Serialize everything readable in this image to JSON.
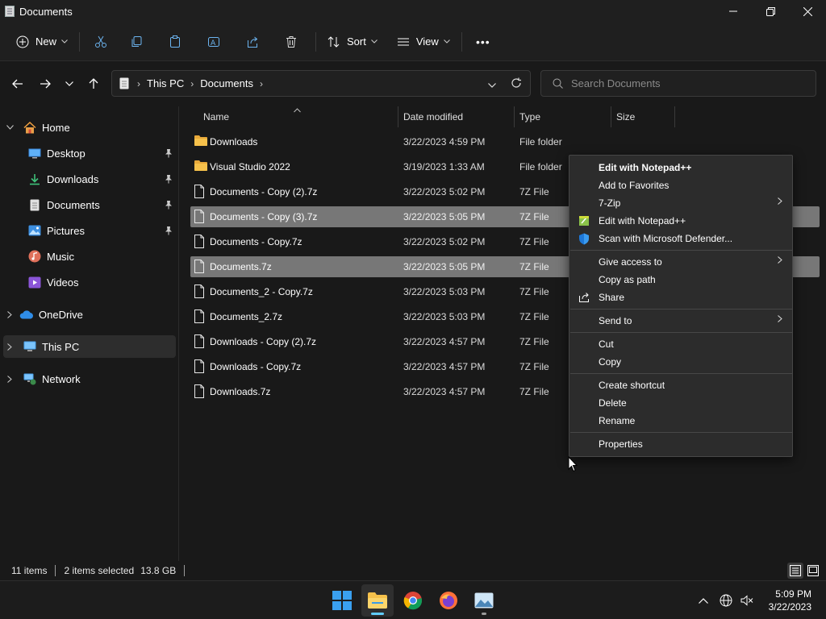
{
  "window": {
    "title": "Documents"
  },
  "toolbar": {
    "new_label": "New",
    "sort_label": "Sort",
    "view_label": "View",
    "more_label": "•••"
  },
  "address": {
    "segments": [
      "This PC",
      "Documents"
    ]
  },
  "search": {
    "placeholder": "Search Documents"
  },
  "sidebar": {
    "items": [
      {
        "label": "Home",
        "icon": "home-icon"
      },
      {
        "label": "Desktop",
        "icon": "desktop-icon",
        "pinned": true
      },
      {
        "label": "Downloads",
        "icon": "download-icon",
        "pinned": true
      },
      {
        "label": "Documents",
        "icon": "document-icon",
        "pinned": true
      },
      {
        "label": "Pictures",
        "icon": "picture-icon",
        "pinned": true
      },
      {
        "label": "Music",
        "icon": "music-icon"
      },
      {
        "label": "Videos",
        "icon": "video-icon"
      },
      {
        "label": "OneDrive",
        "icon": "cloud-icon"
      },
      {
        "label": "This PC",
        "icon": "computer-icon",
        "selected": true
      },
      {
        "label": "Network",
        "icon": "network-icon"
      }
    ]
  },
  "columns": {
    "name": "Name",
    "date": "Date modified",
    "type": "Type",
    "size": "Size"
  },
  "files": [
    {
      "name": "Downloads",
      "date": "3/22/2023 4:59 PM",
      "type": "File folder",
      "kind": "folder",
      "selected": false
    },
    {
      "name": "Visual Studio 2022",
      "date": "3/19/2023 1:33 AM",
      "type": "File folder",
      "kind": "folder",
      "selected": false
    },
    {
      "name": "Documents - Copy (2).7z",
      "date": "3/22/2023 5:02 PM",
      "type": "7Z File",
      "kind": "file",
      "selected": false
    },
    {
      "name": "Documents - Copy (3).7z",
      "date": "3/22/2023 5:05 PM",
      "type": "7Z File",
      "kind": "file",
      "selected": true
    },
    {
      "name": "Documents - Copy.7z",
      "date": "3/22/2023 5:02 PM",
      "type": "7Z File",
      "kind": "file",
      "selected": false
    },
    {
      "name": "Documents.7z",
      "date": "3/22/2023 5:05 PM",
      "type": "7Z File",
      "kind": "file",
      "selected": true
    },
    {
      "name": "Documents_2 - Copy.7z",
      "date": "3/22/2023 5:03 PM",
      "type": "7Z File",
      "kind": "file",
      "selected": false
    },
    {
      "name": "Documents_2.7z",
      "date": "3/22/2023 5:03 PM",
      "type": "7Z File",
      "kind": "file",
      "selected": false
    },
    {
      "name": "Downloads - Copy (2).7z",
      "date": "3/22/2023 4:57 PM",
      "type": "7Z File",
      "kind": "file",
      "selected": false
    },
    {
      "name": "Downloads - Copy.7z",
      "date": "3/22/2023 4:57 PM",
      "type": "7Z File",
      "kind": "file",
      "selected": false
    },
    {
      "name": "Downloads.7z",
      "date": "3/22/2023 4:57 PM",
      "type": "7Z File",
      "kind": "file",
      "selected": false
    }
  ],
  "status": {
    "count": "11 items",
    "selection": "2 items selected",
    "size": "13.8 GB"
  },
  "context_menu": {
    "items": [
      {
        "label": "Edit with Notepad++",
        "bold": true
      },
      {
        "label": "Add to Favorites"
      },
      {
        "label": "7-Zip",
        "submenu": true
      },
      {
        "label": "Edit with Notepad++",
        "icon": "notepad-icon"
      },
      {
        "label": "Scan with Microsoft Defender...",
        "icon": "defender-shield-icon"
      },
      {
        "separator": true
      },
      {
        "label": "Give access to",
        "submenu": true
      },
      {
        "label": "Copy as path"
      },
      {
        "label": "Share",
        "icon": "share-icon"
      },
      {
        "separator": true
      },
      {
        "label": "Send to",
        "submenu": true
      },
      {
        "separator": true
      },
      {
        "label": "Cut"
      },
      {
        "label": "Copy"
      },
      {
        "separator": true
      },
      {
        "label": "Create shortcut"
      },
      {
        "label": "Delete"
      },
      {
        "label": "Rename"
      },
      {
        "separator": true
      },
      {
        "label": "Properties"
      }
    ]
  },
  "clock": {
    "time": "5:09 PM",
    "date": "3/22/2023"
  },
  "colors": {
    "accent": "#60cdff",
    "selection": "#777777",
    "folder": "#f6c14b",
    "background": "#191919"
  }
}
